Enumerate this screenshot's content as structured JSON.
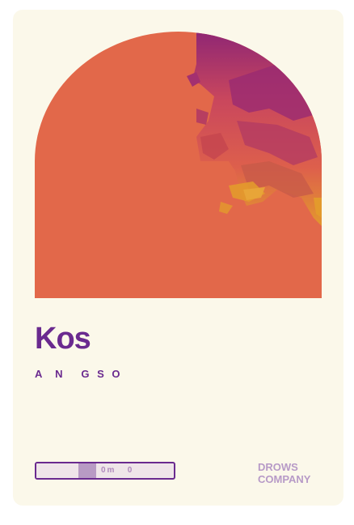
{
  "card": {
    "title": "Kos",
    "subtitle": "A  N   G S O",
    "progress_label": "0m   0",
    "progress_fraction": 0.14,
    "brand_line1": "DROWS",
    "brand_line2": "COMPANY"
  },
  "colors": {
    "card_background": "#fbf8ea",
    "title": "#6a2a8f",
    "subtitle": "#6a2a8f",
    "art_base": "#e2684a",
    "art_accent_purple": "#8b2376",
    "art_accent_orange": "#e39a2c"
  }
}
